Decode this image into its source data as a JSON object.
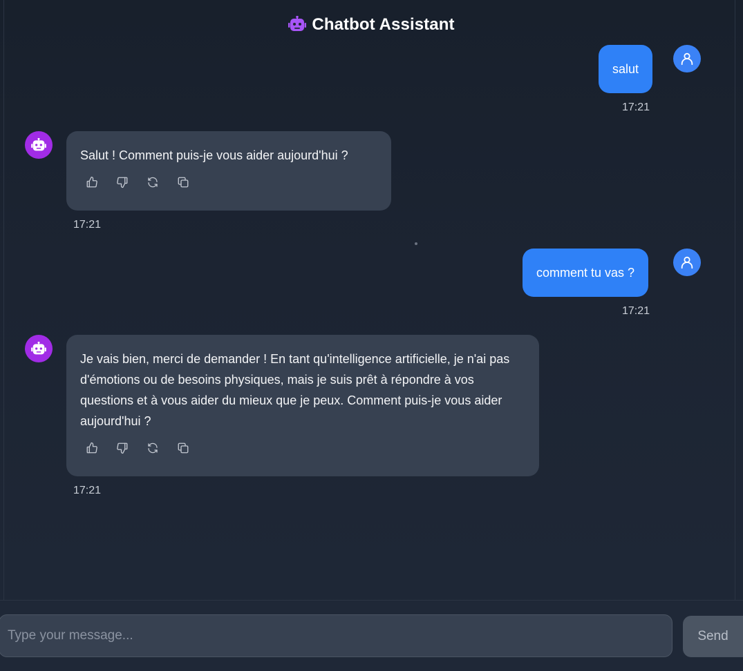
{
  "app": {
    "title": "Chatbot Assistant",
    "accent_user": "#2f81f7",
    "accent_bot": "#a12ce6"
  },
  "messages": [
    {
      "role": "user",
      "text": "salut",
      "time": "17:21"
    },
    {
      "role": "bot",
      "text": "Salut ! Comment puis-je vous aider aujourd'hui ?",
      "time": "17:21"
    },
    {
      "role": "user",
      "text": "comment tu vas ?",
      "time": "17:21"
    },
    {
      "role": "bot",
      "text": "Je vais bien, merci de demander ! En tant qu'intelligence artificielle, je n'ai pas d'émotions ou de besoins physiques, mais je suis prêt à répondre à vos questions et à vous aider du mieux que je peux. Comment puis-je vous aider aujourd'hui ?",
      "time": "17:21"
    }
  ],
  "bot_actions": [
    "thumbs-up-icon",
    "thumbs-down-icon",
    "regenerate-icon",
    "copy-icon"
  ],
  "composer": {
    "placeholder": "Type your message...",
    "value": "",
    "send_label": "Send"
  }
}
